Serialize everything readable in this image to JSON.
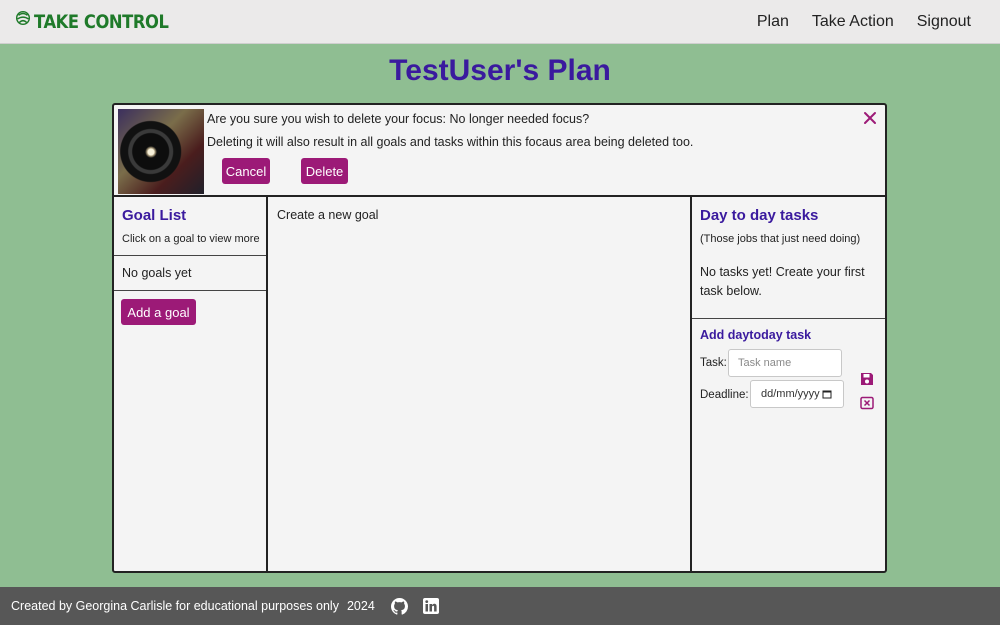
{
  "header": {
    "logo_text": "TAKE CONTROL",
    "nav": [
      "Plan",
      "Take Action",
      "Signout"
    ]
  },
  "page": {
    "title": "TestUser's Plan"
  },
  "confirm": {
    "question": "Are you sure you wish to delete your focus: No longer needed focus?",
    "note": "Deleting it will also result in all goals and tasks within this focaus area being deleted too.",
    "cancel_label": "Cancel",
    "delete_label": "Delete"
  },
  "goals": {
    "heading": "Goal List",
    "subtitle": "Click on a goal to view more",
    "empty_text": "No goals yet",
    "add_label": "Add a goal"
  },
  "main": {
    "create_goal": "Create a new goal"
  },
  "tasks": {
    "heading": "Day to day tasks",
    "subtitle": "(Those jobs that just need doing)",
    "empty_text": "No tasks yet! Create your first task below.",
    "add_heading": "Add daytoday task",
    "task_label": "Task:",
    "task_placeholder": "Task name",
    "deadline_label": "Deadline:",
    "deadline_value": "dd/mm/yyyy"
  },
  "footer": {
    "credit": "Created by Georgina Carlisle for educational purposes only",
    "year": "2024"
  },
  "colors": {
    "brand_green": "#1f7a2a",
    "title_purple": "#3a1a9e",
    "button_magenta": "#9c1a77",
    "page_bg": "#8fbe92",
    "footer_bg": "#575757"
  },
  "icons": [
    "logo-leaf-icon",
    "close-icon",
    "calendar-icon",
    "save-icon",
    "cancel-icon",
    "github-icon",
    "linkedin-icon"
  ]
}
